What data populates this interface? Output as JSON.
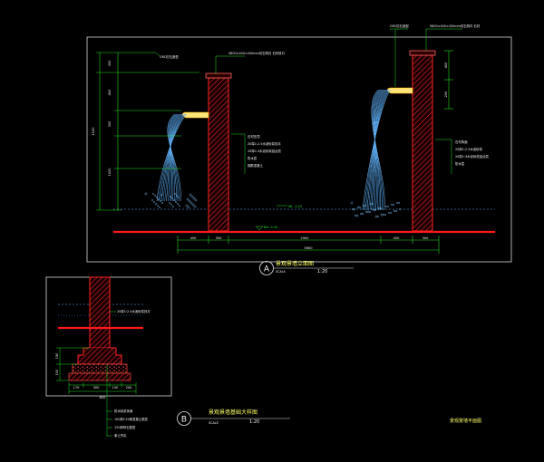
{
  "colors": {
    "background": "#000000",
    "frame": "#d9d9d9",
    "wall": "#ff2020",
    "ground": "#ff1a1a",
    "dimension": "#22dd22",
    "water": "#5bb0ff",
    "title": "#ffff66"
  },
  "elevation_a": {
    "circle_label": "A",
    "title": "景观景墙立面图",
    "scale_prefix": "SCALE",
    "scale": "1:20",
    "height_dims": [
      "300",
      "400",
      "300",
      "1000",
      "2100"
    ],
    "height_dims_right": [
      "400",
      "200"
    ],
    "bottom_dims": [
      "450",
      "300",
      "2900",
      "450",
      "300"
    ],
    "overall_dim": "5600",
    "level_water": "WL -0.20",
    "level_floor": "BM -0.50",
    "labels_left": [
      "GRC仿石造型",
      "5800×400×450mm仿石构件 石材收口",
      "石材压顶",
      "20厚1:2.5水泥砂浆找平",
      "20厚1:3水泥砂浆结合层",
      "防水层",
      "钢筋混凝土"
    ],
    "labels_right": [
      "GRC仿石造型",
      "5800×400×450mm仿石构件 石材",
      "石材饰面",
      "20厚1:2.5水泥砂浆",
      "20厚1:3水泥砂浆结合层",
      "防水层"
    ]
  },
  "detail_b": {
    "circle_label": "B",
    "title": "景观景墙基础大样图",
    "scale_prefix": "SCALE",
    "scale": "1:20",
    "label_mid": "20厚1:2.5水泥砂浆找平",
    "labels_bottom": [
      "防水砂浆抹面",
      "100厚C15素混凝土垫层",
      "150厚碎石垫层",
      "素土夯实"
    ],
    "bottom_dims": [
      "170",
      "300",
      "150",
      "200"
    ],
    "overall_dim": "820",
    "side_dims": [
      "150",
      "100"
    ]
  },
  "plan_caption": "景观景墙平面图"
}
